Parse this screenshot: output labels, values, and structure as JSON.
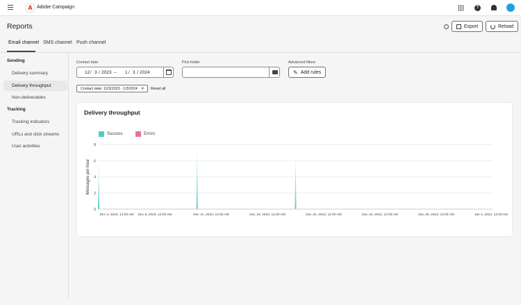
{
  "app": {
    "title": "Adobe Campaign",
    "brand_color": "#eb1000",
    "icons": [
      "menu-icon",
      "apps-grid-icon",
      "help-icon",
      "bell-icon",
      "avatar"
    ]
  },
  "page": {
    "title": "Reports",
    "export_label": "Export",
    "reload_label": "Reload"
  },
  "tabs": [
    {
      "label": "Email channel",
      "active": true
    },
    {
      "label": "SMS channel"
    },
    {
      "label": "Push channel"
    }
  ],
  "sidebar": {
    "sections": [
      {
        "title": "Sending",
        "items": [
          "Delivery summary",
          "Delivery throughput",
          "Non-deliverables"
        ]
      },
      {
        "title": "Tracking",
        "items": [
          "Tracking indicators",
          "URLs and click streams",
          "User activities"
        ]
      }
    ],
    "selected": "Delivery throughput"
  },
  "filters": {
    "contact_date_label": "Contact date",
    "start": {
      "m": "12",
      "d": "3",
      "y": "2023"
    },
    "end": {
      "m": "1",
      "d": "3",
      "y": "2024"
    },
    "pick_folder_label": "Pick folder",
    "pick_folder_value": "",
    "advanced_label": "Advanced filters",
    "add_rules_label": "Add rules",
    "tag": "Contact date: 12/3/2023 - 1/3/2024",
    "reset_label": "Reset all"
  },
  "chart_data": {
    "type": "area",
    "title": "Delivery throughput",
    "ylabel": "Messages per hour",
    "ylim": [
      0,
      8
    ],
    "yticks": [
      "0",
      "2",
      "4",
      "6",
      "8"
    ],
    "xticks": [
      "Dec 4, 2023, 12:00 AM",
      "Dec 8, 2023, 12:00 AM",
      "Dec 12, 2023, 12:00 AM",
      "Dec 16, 2023, 12:00 AM",
      "Dec 20, 2023, 12:00 AM",
      "Dec 24, 2023, 12:00 AM",
      "Dec 28, 2023, 12:00 AM",
      "Jan 1, 2024, 12:00 AM"
    ],
    "legend": [
      {
        "name": "Success",
        "color": "#4ecdc4"
      },
      {
        "name": "Errors",
        "color": "#e86fa3"
      }
    ],
    "series": [
      {
        "name": "Success",
        "points": [
          {
            "x": "2023-12-04",
            "y": 6
          },
          {
            "x": "2023-12-11",
            "y": 8
          },
          {
            "x": "2023-12-18",
            "y": 7
          }
        ]
      },
      {
        "name": "Errors",
        "points": []
      }
    ]
  }
}
